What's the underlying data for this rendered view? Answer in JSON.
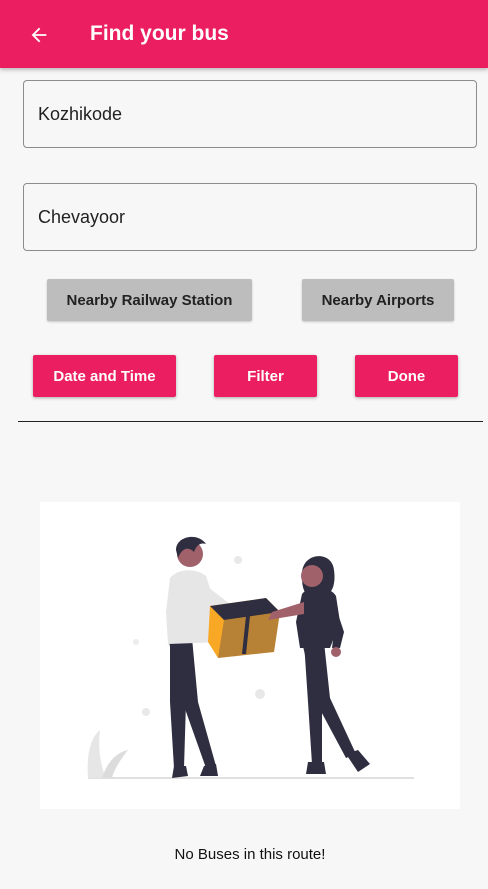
{
  "appbar": {
    "title": "Find your bus",
    "back_icon": "arrow-left-icon",
    "color": "#eb1e62"
  },
  "search": {
    "from_value": "Kozhikode",
    "to_value": "Chevayoor"
  },
  "buttons": {
    "railway_label": "Nearby Railway Station",
    "airports_label": "Nearby Airports",
    "date_label": "Date and Time",
    "filter_label": "Filter",
    "done_label": "Done"
  },
  "results": {
    "illustration_icon": "people-exchanging-package-illustration",
    "empty_message": "No Buses in this route!"
  }
}
